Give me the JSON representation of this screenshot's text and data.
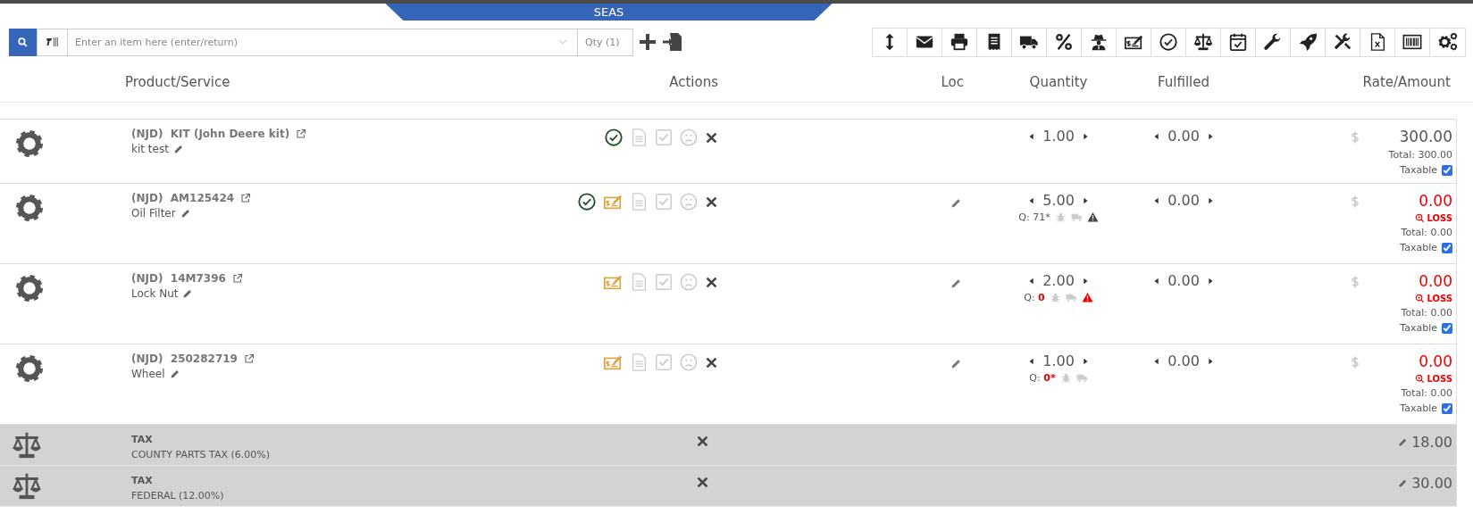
{
  "banner": {
    "title": "SEAS"
  },
  "search": {
    "placeholder": "Enter an item here (enter/return)",
    "qty_placeholder": "Qty (1)"
  },
  "columns": [
    "Product/Service",
    "Actions",
    "Loc",
    "Quantity",
    "Fulfilled",
    "Rate/Amount"
  ],
  "items": [
    {
      "vendor": "(NJD)",
      "part": "KIT (John Deere kit)",
      "description": "kit test",
      "approved": true,
      "price_override": false,
      "loc_editable": false,
      "quantity": "1.00",
      "fulfilled": "0.00",
      "amount": "300.00",
      "loss": false,
      "total": "Total: 300.00",
      "taxable_label": "Taxable",
      "taxable": true
    },
    {
      "vendor": "(NJD)",
      "part": "AM125424",
      "description": "Oil Filter",
      "approved": true,
      "price_override": true,
      "loc_editable": true,
      "quantity": "5.00",
      "stock": {
        "label": "Q:",
        "value": "71*",
        "low": false,
        "warning": true,
        "critical": false
      },
      "fulfilled": "0.00",
      "amount": "0.00",
      "loss": true,
      "loss_label": "LOSS",
      "total": "Total: 0.00",
      "taxable_label": "Taxable",
      "taxable": true
    },
    {
      "vendor": "(NJD)",
      "part": "14M7396",
      "description": "Lock Nut",
      "approved": false,
      "price_override": true,
      "loc_editable": true,
      "quantity": "2.00",
      "stock": {
        "label": "Q:",
        "value": "0",
        "low": true,
        "warning": true,
        "critical": true
      },
      "fulfilled": "0.00",
      "amount": "0.00",
      "loss": true,
      "loss_label": "LOSS",
      "total": "Total: 0.00",
      "taxable_label": "Taxable",
      "taxable": true
    },
    {
      "vendor": "(NJD)",
      "part": "250282719",
      "description": "Wheel",
      "approved": false,
      "price_override": true,
      "loc_editable": true,
      "quantity": "1.00",
      "stock": {
        "label": "Q:",
        "value": "0*",
        "low": true,
        "warning": false
      },
      "fulfilled": "0.00",
      "amount": "0.00",
      "loss": true,
      "loss_label": "LOSS",
      "total": "Total: 0.00",
      "taxable_label": "Taxable",
      "taxable": true
    }
  ],
  "taxes": [
    {
      "title": "TAX",
      "description": "COUNTY PARTS TAX (6.00%)",
      "amount": "18.00"
    },
    {
      "title": "TAX",
      "description": "FEDERAL (12.00%)",
      "amount": "30.00"
    }
  ]
}
